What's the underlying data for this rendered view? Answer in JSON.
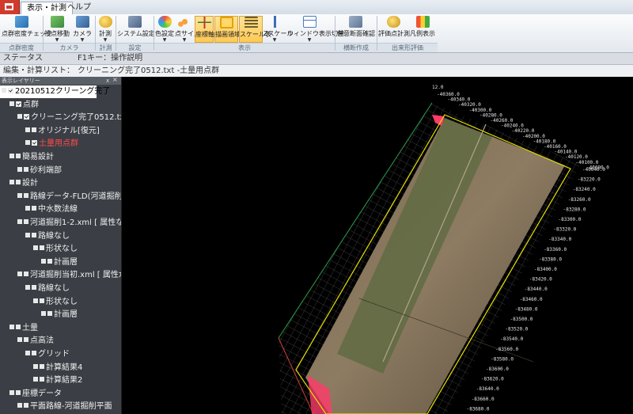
{
  "ribbon": {
    "tabs": [
      "表示・計測",
      "ヘルプ"
    ],
    "buttons": [
      {
        "label": "点群密度チェック"
      },
      {
        "label": "視点移動"
      },
      {
        "label": "カメラ"
      },
      {
        "label": "計測"
      },
      {
        "label": "システム設定"
      },
      {
        "label": "色設定"
      },
      {
        "label": "点サイズ"
      },
      {
        "label": "座標軸"
      },
      {
        "label": "描画領域"
      },
      {
        "label": "スケール表"
      },
      {
        "label": "Zスケール"
      },
      {
        "label": "ウィンドウ表示切替"
      },
      {
        "label": "任意断面確認"
      },
      {
        "label": "評価点計測"
      },
      {
        "label": "凡例表示"
      }
    ],
    "groups": [
      "点群密度",
      "カメラ",
      "計測",
      "設定",
      "表示",
      "横断作成",
      "出来形評価"
    ]
  },
  "status": {
    "label": "ステータス",
    "text": "F1キー：操作説明"
  },
  "edit": {
    "label": "編集・計算リスト：",
    "value": "クリーニング完了0512.txt -土量用点群"
  },
  "panel": {
    "title": "表示レイヤリー",
    "pin": "ⅹ",
    "tree": [
      {
        "text": "20210512クリーング完了",
        "level": 0,
        "box": "check",
        "sel": true
      },
      {
        "text": "点群",
        "level": 1,
        "box": "check"
      },
      {
        "text": "クリーニング完了0512.txt",
        "level": 2,
        "box": "check"
      },
      {
        "text": "オリジナル[復元]",
        "level": 3,
        "box": "plain"
      },
      {
        "text": "土量用点群",
        "level": 3,
        "box": "check",
        "red": true
      },
      {
        "text": "簡易設計",
        "level": 1,
        "box": "plain"
      },
      {
        "text": "砂利端部",
        "level": 2,
        "box": "plain"
      },
      {
        "text": "設計",
        "level": 1,
        "box": "plain"
      },
      {
        "text": "路線データ-FLD(河道掘削",
        "level": 2,
        "box": "plain"
      },
      {
        "text": "中水数法線",
        "level": 3,
        "box": "plain"
      },
      {
        "text": "河道掘削1-2.xml [ 属性な",
        "level": 2,
        "box": "plain"
      },
      {
        "text": "路線なし",
        "level": 3,
        "box": "plain"
      },
      {
        "text": "形状なし",
        "level": 4,
        "box": "plain"
      },
      {
        "text": "計画層",
        "level": 5,
        "box": "plain"
      },
      {
        "text": "河道掘削当初.xml [ 属性が",
        "level": 2,
        "box": "plain"
      },
      {
        "text": "路線なし",
        "level": 3,
        "box": "plain"
      },
      {
        "text": "形状なし",
        "level": 4,
        "box": "plain"
      },
      {
        "text": "計画層",
        "level": 5,
        "box": "plain"
      },
      {
        "text": "土量",
        "level": 1,
        "box": "plain"
      },
      {
        "text": "点高法",
        "level": 2,
        "box": "plain"
      },
      {
        "text": "グリッド",
        "level": 3,
        "box": "plain"
      },
      {
        "text": "計算結果4",
        "level": 4,
        "box": "plain"
      },
      {
        "text": "計算結果2",
        "level": 4,
        "box": "plain"
      },
      {
        "text": "座標データ",
        "level": 1,
        "box": "plain"
      },
      {
        "text": "平面路線-河道掘削平面",
        "level": 2,
        "box": "plain"
      }
    ]
  },
  "viewport": {
    "top_label": "12.0",
    "top_ticks": [
      "-40360.0",
      "-40340.0",
      "-40320.0",
      "-40300.0",
      "-40280.0",
      "-40260.0",
      "-40240.0",
      "-40220.0",
      "-40200.0",
      "-40180.0",
      "-40160.0",
      "-40140.0",
      "-40120.0",
      "-40100.0",
      "-40080.0"
    ],
    "right_ticks": [
      "-40040.0",
      "-83220.0",
      "-83240.0",
      "-83260.0",
      "-83280.0",
      "-83300.0",
      "-83320.0",
      "-83340.0",
      "-83360.0",
      "-83380.0",
      "-83400.0",
      "-83420.0",
      "-83440.0",
      "-83460.0",
      "-83480.0",
      "-83500.0",
      "-83520.0",
      "-83540.0",
      "-83560.0",
      "-83580.0",
      "-83600.0",
      "-83620.0",
      "-83640.0",
      "-83660.0",
      "-83680.0",
      "-83700.0"
    ],
    "colors": {
      "frame": "#e6e000",
      "background": "#000000"
    }
  }
}
